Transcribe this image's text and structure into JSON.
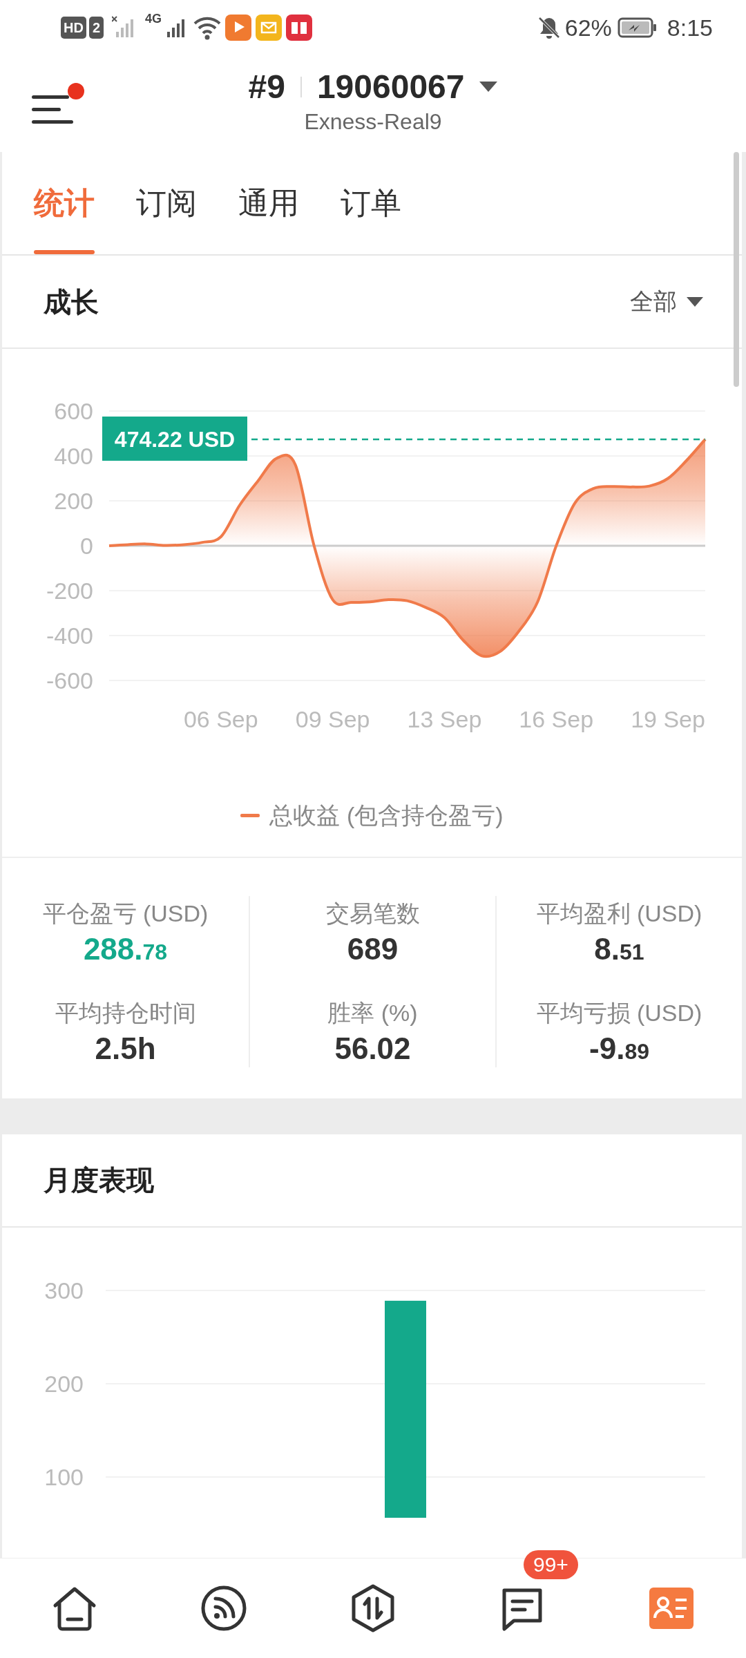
{
  "status_bar": {
    "hd_badge": "HD",
    "sim": "2",
    "network": "4G",
    "battery": "62%",
    "time": "8:15"
  },
  "header": {
    "menu_dot": true,
    "account_index": "#9",
    "account_number": "19060067",
    "server": "Exness-Real9"
  },
  "tabs": [
    {
      "label": "统计",
      "selected": true
    },
    {
      "label": "订阅",
      "selected": false
    },
    {
      "label": "通用",
      "selected": false
    },
    {
      "label": "订单",
      "selected": false
    }
  ],
  "growth": {
    "title": "成长",
    "filter": "全部",
    "chart_data": {
      "type": "area",
      "categories": [
        null,
        null,
        null,
        null,
        null,
        null,
        "06 Sep",
        null,
        null,
        null,
        null,
        null,
        "09 Sep",
        null,
        null,
        null,
        null,
        null,
        "13 Sep",
        null,
        null,
        null,
        null,
        null,
        "16 Sep",
        null,
        null,
        null,
        null,
        null,
        "19 Sep",
        null,
        null
      ],
      "series": [
        {
          "name": "总收益 (包含持仓盈亏)",
          "color": "#f07a4a",
          "values": [
            0,
            5,
            8,
            2,
            5,
            15,
            40,
            180,
            290,
            390,
            360,
            0,
            -240,
            -252,
            -250,
            -240,
            -245,
            -275,
            -320,
            -420,
            -490,
            -470,
            -380,
            -250,
            0,
            190,
            255,
            264,
            262,
            266,
            300,
            380,
            474
          ]
        }
      ],
      "ylim": [
        -600,
        600
      ],
      "grid": true,
      "yticks": [
        600,
        400,
        200,
        0,
        -200,
        -400,
        -600
      ],
      "annotations": [
        "474.22 USD"
      ]
    }
  },
  "stats": [
    {
      "label": "平仓盈亏 (USD)",
      "value": "288.",
      "decimals": "78",
      "color": "#14a98b"
    },
    {
      "label": "交易笔数",
      "value": "689",
      "color": "#333333"
    },
    {
      "label": "平均盈利 (USD)",
      "value": "8.",
      "decimals": "51",
      "color": "#333333"
    },
    {
      "label": "平均持仓时间",
      "value": "2.5h",
      "color": "#333333"
    },
    {
      "label": "胜率 (%)",
      "value": "56.02",
      "color": "#333333"
    },
    {
      "label": "平均亏损 (USD)",
      "value": "-9.",
      "decimals": "89",
      "color": "#333333"
    }
  ],
  "monthly": {
    "title": "月度表现",
    "chart_data": {
      "type": "bar",
      "categories": [
        null,
        null,
        null,
        null,
        null
      ],
      "values": [
        null,
        null,
        289,
        null,
        null
      ],
      "ylim": [
        0,
        300
      ],
      "grid": true,
      "yticks": [
        100,
        200,
        300
      ]
    }
  },
  "bottom_nav": [
    {
      "selected": false
    },
    {
      "selected": false
    },
    {
      "selected": false
    },
    {
      "selected": false,
      "badge": "99+"
    },
    {
      "selected": true
    }
  ]
}
